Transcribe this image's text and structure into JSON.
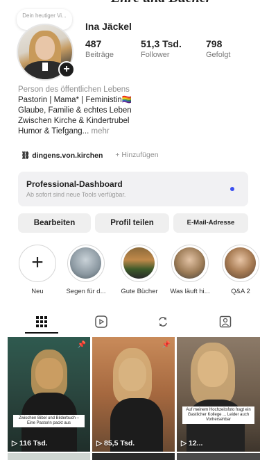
{
  "profile": {
    "note": "Dein heutiger Vi...",
    "username": "Ina Jäckel",
    "stats": [
      {
        "value": "487",
        "label": "Beiträge"
      },
      {
        "value": "51,3 Tsd.",
        "label": "Follower"
      },
      {
        "value": "798",
        "label": "Gefolgt"
      }
    ],
    "category": "Person des öffentlichen Lebens",
    "bio_lines": [
      "Pastorin | Mama* | Feministin🏳️‍🌈",
      "Glaube, Familie & echtes Leben",
      "Zwischen Kirche & Kindertrubel",
      "Humor & Tiefgang..."
    ],
    "more": "mehr",
    "link": "dingens.von.kirchen",
    "add_link": "+ Hinzufügen"
  },
  "dashboard": {
    "title": "Professional-Dashboard",
    "subtitle": "Ab sofort sind neue Tools verfügbar."
  },
  "buttons": {
    "edit": "Bearbeiten",
    "share": "Profil teilen",
    "email": "E-Mail-Adresse"
  },
  "highlights": [
    {
      "label": "Neu",
      "icon": "plus-icon"
    },
    {
      "label": "Segen für d..."
    },
    {
      "label": "Gute Bücher"
    },
    {
      "label": "Was läuft hi..."
    },
    {
      "label": "Q&A 2"
    }
  ],
  "tabs": [
    {
      "icon": "grid-icon",
      "active": true
    },
    {
      "icon": "reels-icon",
      "active": false
    },
    {
      "icon": "reposts-icon",
      "active": false
    },
    {
      "icon": "tagged-icon",
      "active": false
    }
  ],
  "posts": [
    {
      "views": "116 Tsd.",
      "banner": "Zwischen Bibel und Bilderbuch – Eine Pastorin packt aus",
      "pinned": true
    },
    {
      "views": "85,5 Tsd.",
      "pinned": true
    },
    {
      "views": "12...",
      "banner": "Auf meinem Hochzeitsfoto fragt ein Gastlicher Kollege ... Leider auch Vorhersehbar"
    }
  ],
  "colors": {
    "accent_dot": "#3b4ff0",
    "button_bg": "#efefef",
    "dashboard_bg": "#f1f1f3",
    "muted_text": "#8e8e8e"
  }
}
